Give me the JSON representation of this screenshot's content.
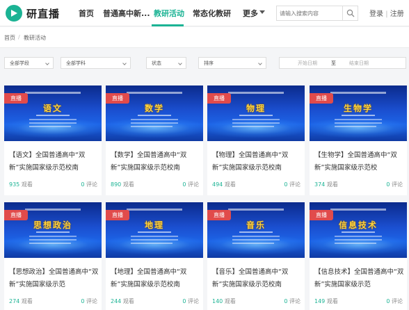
{
  "header": {
    "brand": "研直播",
    "nav": [
      "首页",
      "普通高中新...",
      "教研活动",
      "常态化教研",
      "更多"
    ],
    "active_nav": "教研活动",
    "search_placeholder": "请输入搜索内容",
    "login": "登录",
    "separator": "|",
    "register": "注册",
    "accent_color": "#1bb394"
  },
  "breadcrumb": {
    "home": "首页",
    "sep": "/",
    "current": "教研活动"
  },
  "filters": {
    "stage": "全部学段",
    "subject": "全部学科",
    "status": "状态",
    "sort": "排序",
    "date_start": "开始日期",
    "date_sep": "至",
    "date_end": "结束日期"
  },
  "cards": [
    {
      "badge": "直播",
      "subject": "语文",
      "title": "【语文】全国普通高中“双新”实施国家级示范校南",
      "views": "935",
      "views_label": "观看",
      "comments": "0",
      "comments_label": "评论"
    },
    {
      "badge": "直播",
      "subject": "数学",
      "title": "【数学】全国普通高中“双新”实施国家级示范校南",
      "views": "890",
      "views_label": "观看",
      "comments": "0",
      "comments_label": "评论"
    },
    {
      "badge": "直播",
      "subject": "物理",
      "title": "【物理】全国普通高中“双新”实施国家级示范校南",
      "views": "494",
      "views_label": "观看",
      "comments": "0",
      "comments_label": "评论"
    },
    {
      "badge": "直播",
      "subject": "生物学",
      "title": "【生物学】全国普通高中“双新”实施国家级示范校",
      "views": "374",
      "views_label": "观看",
      "comments": "0",
      "comments_label": "评论"
    },
    {
      "badge": "直播",
      "subject": "思想政治",
      "title": "【思想政治】全国普通高中“双新”实施国家级示范",
      "views": "274",
      "views_label": "观看",
      "comments": "0",
      "comments_label": "评论"
    },
    {
      "badge": "直播",
      "subject": "地理",
      "title": "【地理】全国普通高中“双新”实施国家级示范校南",
      "views": "244",
      "views_label": "观看",
      "comments": "0",
      "comments_label": "评论"
    },
    {
      "badge": "直播",
      "subject": "音乐",
      "title": "【音乐】全国普通高中“双新”实施国家级示范校南",
      "views": "140",
      "views_label": "观看",
      "comments": "0",
      "comments_label": "评论"
    },
    {
      "badge": "直播",
      "subject": "信息技术",
      "title": "【信息技术】全国普通高中“双新”实施国家级示范",
      "views": "149",
      "views_label": "观看",
      "comments": "0",
      "comments_label": "评论"
    }
  ]
}
